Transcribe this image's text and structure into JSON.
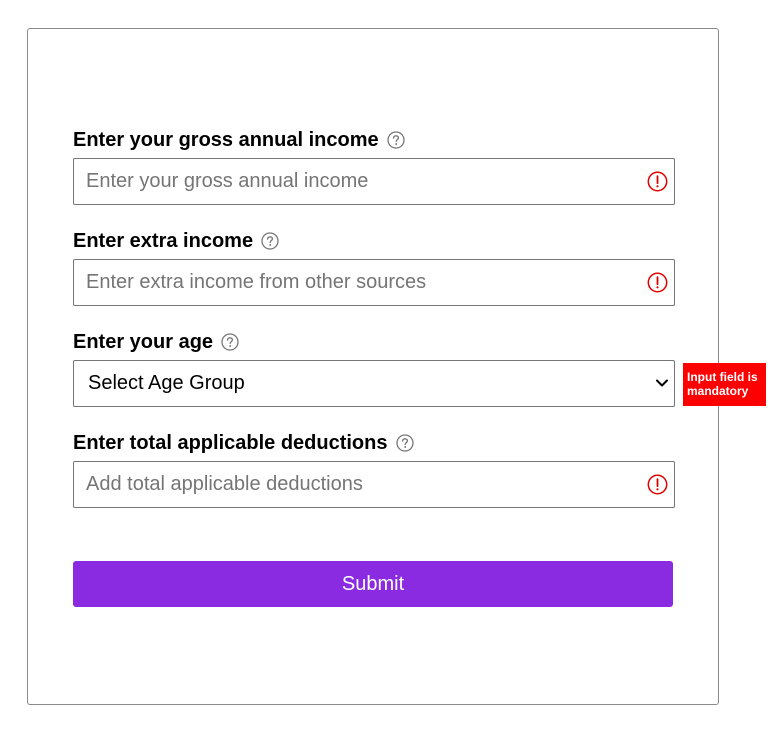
{
  "form": {
    "gross_income": {
      "label": "Enter your gross annual income",
      "placeholder": "Enter your gross annual income",
      "value": ""
    },
    "extra_income": {
      "label": "Enter extra income",
      "placeholder": "Enter extra income from other sources",
      "value": ""
    },
    "age": {
      "label": "Enter your age",
      "selected": "Select Age Group"
    },
    "deductions": {
      "label": "Enter total applicable deductions",
      "placeholder": "Add total applicable deductions",
      "value": ""
    },
    "tooltip": "Input field is mandatory",
    "submit_label": "Submit"
  },
  "icons": {
    "help": "question-circle-icon",
    "error": "exclamation-circle-icon",
    "dropdown": "chevron-down-icon"
  },
  "colors": {
    "accent": "#8a2be2",
    "error": "#ff0000",
    "error_icon": "#e00000"
  }
}
